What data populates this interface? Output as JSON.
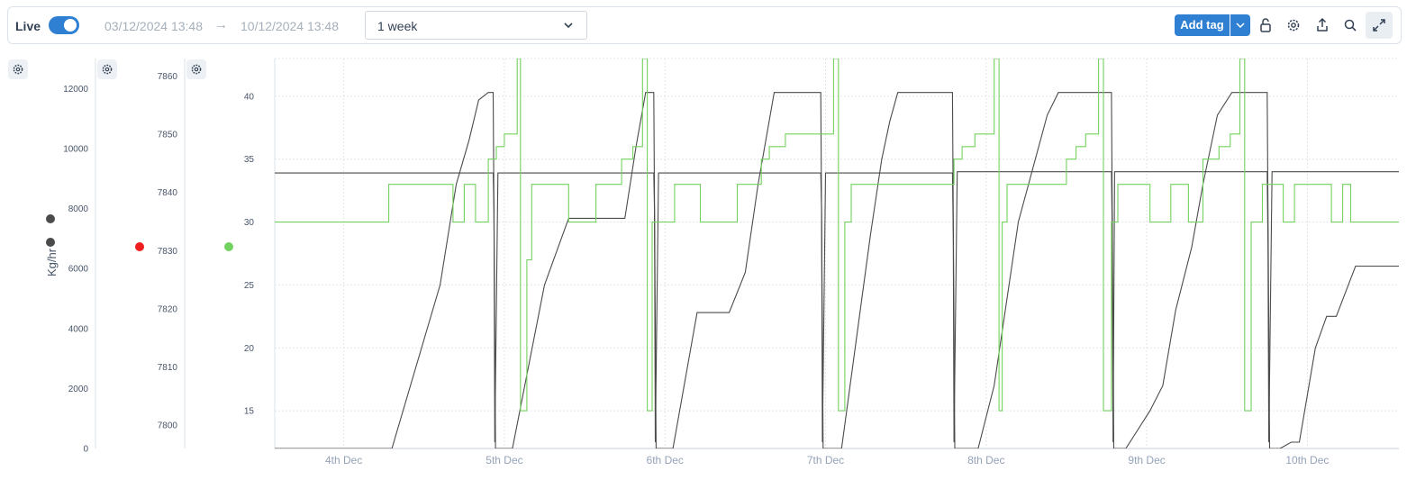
{
  "toolbar": {
    "live_label": "Live",
    "live_on": true,
    "start_date": "03/12/2024 13:48",
    "end_date": "10/12/2024 13:48",
    "range": "1 week",
    "add_tag_label": "Add tag",
    "icons": [
      "unlock-icon",
      "gear-icon",
      "share-icon",
      "search-icon",
      "expand-icon"
    ]
  },
  "colors": {
    "accent": "#2f7fd3",
    "series_dark": "#4b4b4b",
    "series_green": "#73d25f",
    "marker_red": "#f01e1e",
    "grid": "#dfe4ea"
  },
  "chart_data": {
    "type": "line",
    "x_ticks": [
      "4th Dec",
      "5th Dec",
      "6th Dec",
      "7th Dec",
      "8th Dec",
      "9th Dec",
      "10th Dec"
    ],
    "x_range_days": [
      3.57,
      10.57
    ],
    "axes": [
      {
        "id": "axis1",
        "label": "Kg/hr",
        "ylim": [
          0,
          13000
        ],
        "ticks": [
          0,
          2000,
          4000,
          6000,
          8000,
          10000,
          12000
        ],
        "markers": [
          "#4b4b4b",
          "#4b4b4b"
        ]
      },
      {
        "id": "axis2",
        "label": "",
        "ylim": [
          7796,
          7863
        ],
        "ticks": [
          7800,
          7810,
          7820,
          7830,
          7840,
          7850,
          7860
        ],
        "markers": [
          "#f01e1e"
        ]
      },
      {
        "id": "axis3",
        "label": "",
        "ylim": [
          12,
          43
        ],
        "ticks": [
          15,
          20,
          25,
          30,
          35,
          40
        ],
        "markers": [
          "#73d25f"
        ]
      }
    ],
    "series": [
      {
        "color": "#4b4b4b",
        "points": [
          [
            3.57,
            33.9
          ],
          [
            4.93,
            33.9
          ],
          [
            4.935,
            31
          ],
          [
            4.94,
            12.5
          ],
          [
            4.96,
            33.9
          ],
          [
            5.93,
            33.9
          ],
          [
            5.935,
            31
          ],
          [
            5.94,
            12.5
          ],
          [
            5.96,
            33.9
          ],
          [
            6.97,
            33.9
          ],
          [
            6.975,
            31
          ],
          [
            6.98,
            12.5
          ],
          [
            7.0,
            33.9
          ],
          [
            7.79,
            33.9
          ],
          [
            7.795,
            29
          ],
          [
            7.8,
            12.5
          ],
          [
            7.82,
            34.0
          ],
          [
            8.78,
            34.0
          ],
          [
            8.785,
            29
          ],
          [
            8.79,
            12.5
          ],
          [
            8.8,
            34.0
          ],
          [
            9.75,
            34.0
          ],
          [
            9.755,
            28
          ],
          [
            9.76,
            12.5
          ],
          [
            9.78,
            34.0
          ],
          [
            10.57,
            34.0
          ]
        ]
      },
      {
        "color": "#4b4b4b",
        "points": [
          [
            3.57,
            12
          ],
          [
            4.3,
            12
          ],
          [
            4.6,
            25
          ],
          [
            4.7,
            33
          ],
          [
            4.78,
            36.5
          ],
          [
            4.84,
            39.7
          ],
          [
            4.9,
            40.3
          ],
          [
            4.93,
            40.3
          ],
          [
            4.945,
            12
          ],
          [
            5.05,
            12
          ],
          [
            5.25,
            25
          ],
          [
            5.4,
            30.3
          ],
          [
            5.75,
            30.3
          ],
          [
            5.82,
            36
          ],
          [
            5.88,
            40.3
          ],
          [
            5.93,
            40.3
          ],
          [
            5.945,
            12
          ],
          [
            6.05,
            12
          ],
          [
            6.2,
            22.8
          ],
          [
            6.4,
            22.8
          ],
          [
            6.5,
            26
          ],
          [
            6.58,
            33
          ],
          [
            6.68,
            40.3
          ],
          [
            6.97,
            40.3
          ],
          [
            6.985,
            12
          ],
          [
            7.1,
            12
          ],
          [
            7.28,
            29
          ],
          [
            7.35,
            35
          ],
          [
            7.4,
            38
          ],
          [
            7.45,
            40.3
          ],
          [
            7.79,
            40.3
          ],
          [
            7.805,
            12
          ],
          [
            7.95,
            12
          ],
          [
            8.05,
            17
          ],
          [
            8.2,
            30
          ],
          [
            8.38,
            38.5
          ],
          [
            8.45,
            40.3
          ],
          [
            8.78,
            40.3
          ],
          [
            8.795,
            12
          ],
          [
            8.87,
            12
          ],
          [
            9.02,
            15
          ],
          [
            9.1,
            17
          ],
          [
            9.18,
            23
          ],
          [
            9.28,
            28
          ],
          [
            9.35,
            33
          ],
          [
            9.44,
            38.5
          ],
          [
            9.53,
            40.3
          ],
          [
            9.75,
            40.3
          ],
          [
            9.765,
            12
          ],
          [
            9.83,
            12
          ],
          [
            9.9,
            12.5
          ],
          [
            9.95,
            12.5
          ],
          [
            10.05,
            20
          ],
          [
            10.12,
            22.5
          ],
          [
            10.18,
            22.5
          ],
          [
            10.3,
            26.5
          ],
          [
            10.57,
            26.5
          ]
        ]
      },
      {
        "color": "#73d25f",
        "points": [
          [
            3.57,
            30
          ],
          [
            4.28,
            30
          ],
          [
            4.28,
            33
          ],
          [
            4.68,
            33
          ],
          [
            4.68,
            30
          ],
          [
            4.75,
            30
          ],
          [
            4.75,
            33
          ],
          [
            4.82,
            33
          ],
          [
            4.82,
            30
          ],
          [
            4.9,
            30
          ],
          [
            4.9,
            35
          ],
          [
            4.95,
            35
          ],
          [
            4.95,
            36
          ],
          [
            5.0,
            36
          ],
          [
            5.0,
            37
          ],
          [
            5.08,
            37
          ],
          [
            5.08,
            43
          ],
          [
            5.1,
            43
          ],
          [
            5.1,
            15
          ],
          [
            5.14,
            15
          ],
          [
            5.14,
            27
          ],
          [
            5.17,
            27
          ],
          [
            5.17,
            33
          ],
          [
            5.4,
            33
          ],
          [
            5.4,
            30
          ],
          [
            5.57,
            30
          ],
          [
            5.57,
            33
          ],
          [
            5.73,
            33
          ],
          [
            5.73,
            35
          ],
          [
            5.8,
            35
          ],
          [
            5.8,
            36
          ],
          [
            5.86,
            36
          ],
          [
            5.86,
            43
          ],
          [
            5.89,
            43
          ],
          [
            5.89,
            15
          ],
          [
            5.92,
            15
          ],
          [
            5.92,
            30
          ],
          [
            6.06,
            30
          ],
          [
            6.06,
            33
          ],
          [
            6.22,
            33
          ],
          [
            6.22,
            30
          ],
          [
            6.45,
            30
          ],
          [
            6.45,
            33
          ],
          [
            6.6,
            33
          ],
          [
            6.6,
            35
          ],
          [
            6.65,
            35
          ],
          [
            6.65,
            36
          ],
          [
            6.75,
            36
          ],
          [
            6.75,
            37
          ],
          [
            7.05,
            37
          ],
          [
            7.05,
            43
          ],
          [
            7.08,
            43
          ],
          [
            7.08,
            15
          ],
          [
            7.12,
            15
          ],
          [
            7.12,
            30
          ],
          [
            7.16,
            30
          ],
          [
            7.16,
            33
          ],
          [
            7.8,
            33
          ],
          [
            7.8,
            35
          ],
          [
            7.85,
            35
          ],
          [
            7.85,
            36
          ],
          [
            7.93,
            36
          ],
          [
            7.93,
            37
          ],
          [
            8.05,
            37
          ],
          [
            8.05,
            43
          ],
          [
            8.08,
            43
          ],
          [
            8.08,
            15
          ],
          [
            8.1,
            15
          ],
          [
            8.1,
            30
          ],
          [
            8.13,
            30
          ],
          [
            8.13,
            33
          ],
          [
            8.5,
            33
          ],
          [
            8.5,
            35
          ],
          [
            8.56,
            35
          ],
          [
            8.56,
            36
          ],
          [
            8.62,
            36
          ],
          [
            8.62,
            37
          ],
          [
            8.7,
            37
          ],
          [
            8.7,
            43
          ],
          [
            8.73,
            43
          ],
          [
            8.73,
            15
          ],
          [
            8.78,
            15
          ],
          [
            8.78,
            30
          ],
          [
            8.82,
            30
          ],
          [
            8.82,
            33
          ],
          [
            9.02,
            33
          ],
          [
            9.02,
            30
          ],
          [
            9.15,
            30
          ],
          [
            9.15,
            33
          ],
          [
            9.26,
            33
          ],
          [
            9.26,
            30
          ],
          [
            9.35,
            30
          ],
          [
            9.35,
            35
          ],
          [
            9.45,
            35
          ],
          [
            9.45,
            36
          ],
          [
            9.52,
            36
          ],
          [
            9.52,
            37
          ],
          [
            9.58,
            37
          ],
          [
            9.58,
            43
          ],
          [
            9.61,
            43
          ],
          [
            9.61,
            15
          ],
          [
            9.65,
            15
          ],
          [
            9.65,
            30
          ],
          [
            9.72,
            30
          ],
          [
            9.72,
            33
          ],
          [
            9.85,
            33
          ],
          [
            9.85,
            30
          ],
          [
            9.92,
            30
          ],
          [
            9.92,
            33
          ],
          [
            10.15,
            33
          ],
          [
            10.15,
            30
          ],
          [
            10.22,
            30
          ],
          [
            10.22,
            33
          ],
          [
            10.27,
            33
          ],
          [
            10.27,
            30
          ],
          [
            10.57,
            30
          ]
        ]
      }
    ]
  }
}
